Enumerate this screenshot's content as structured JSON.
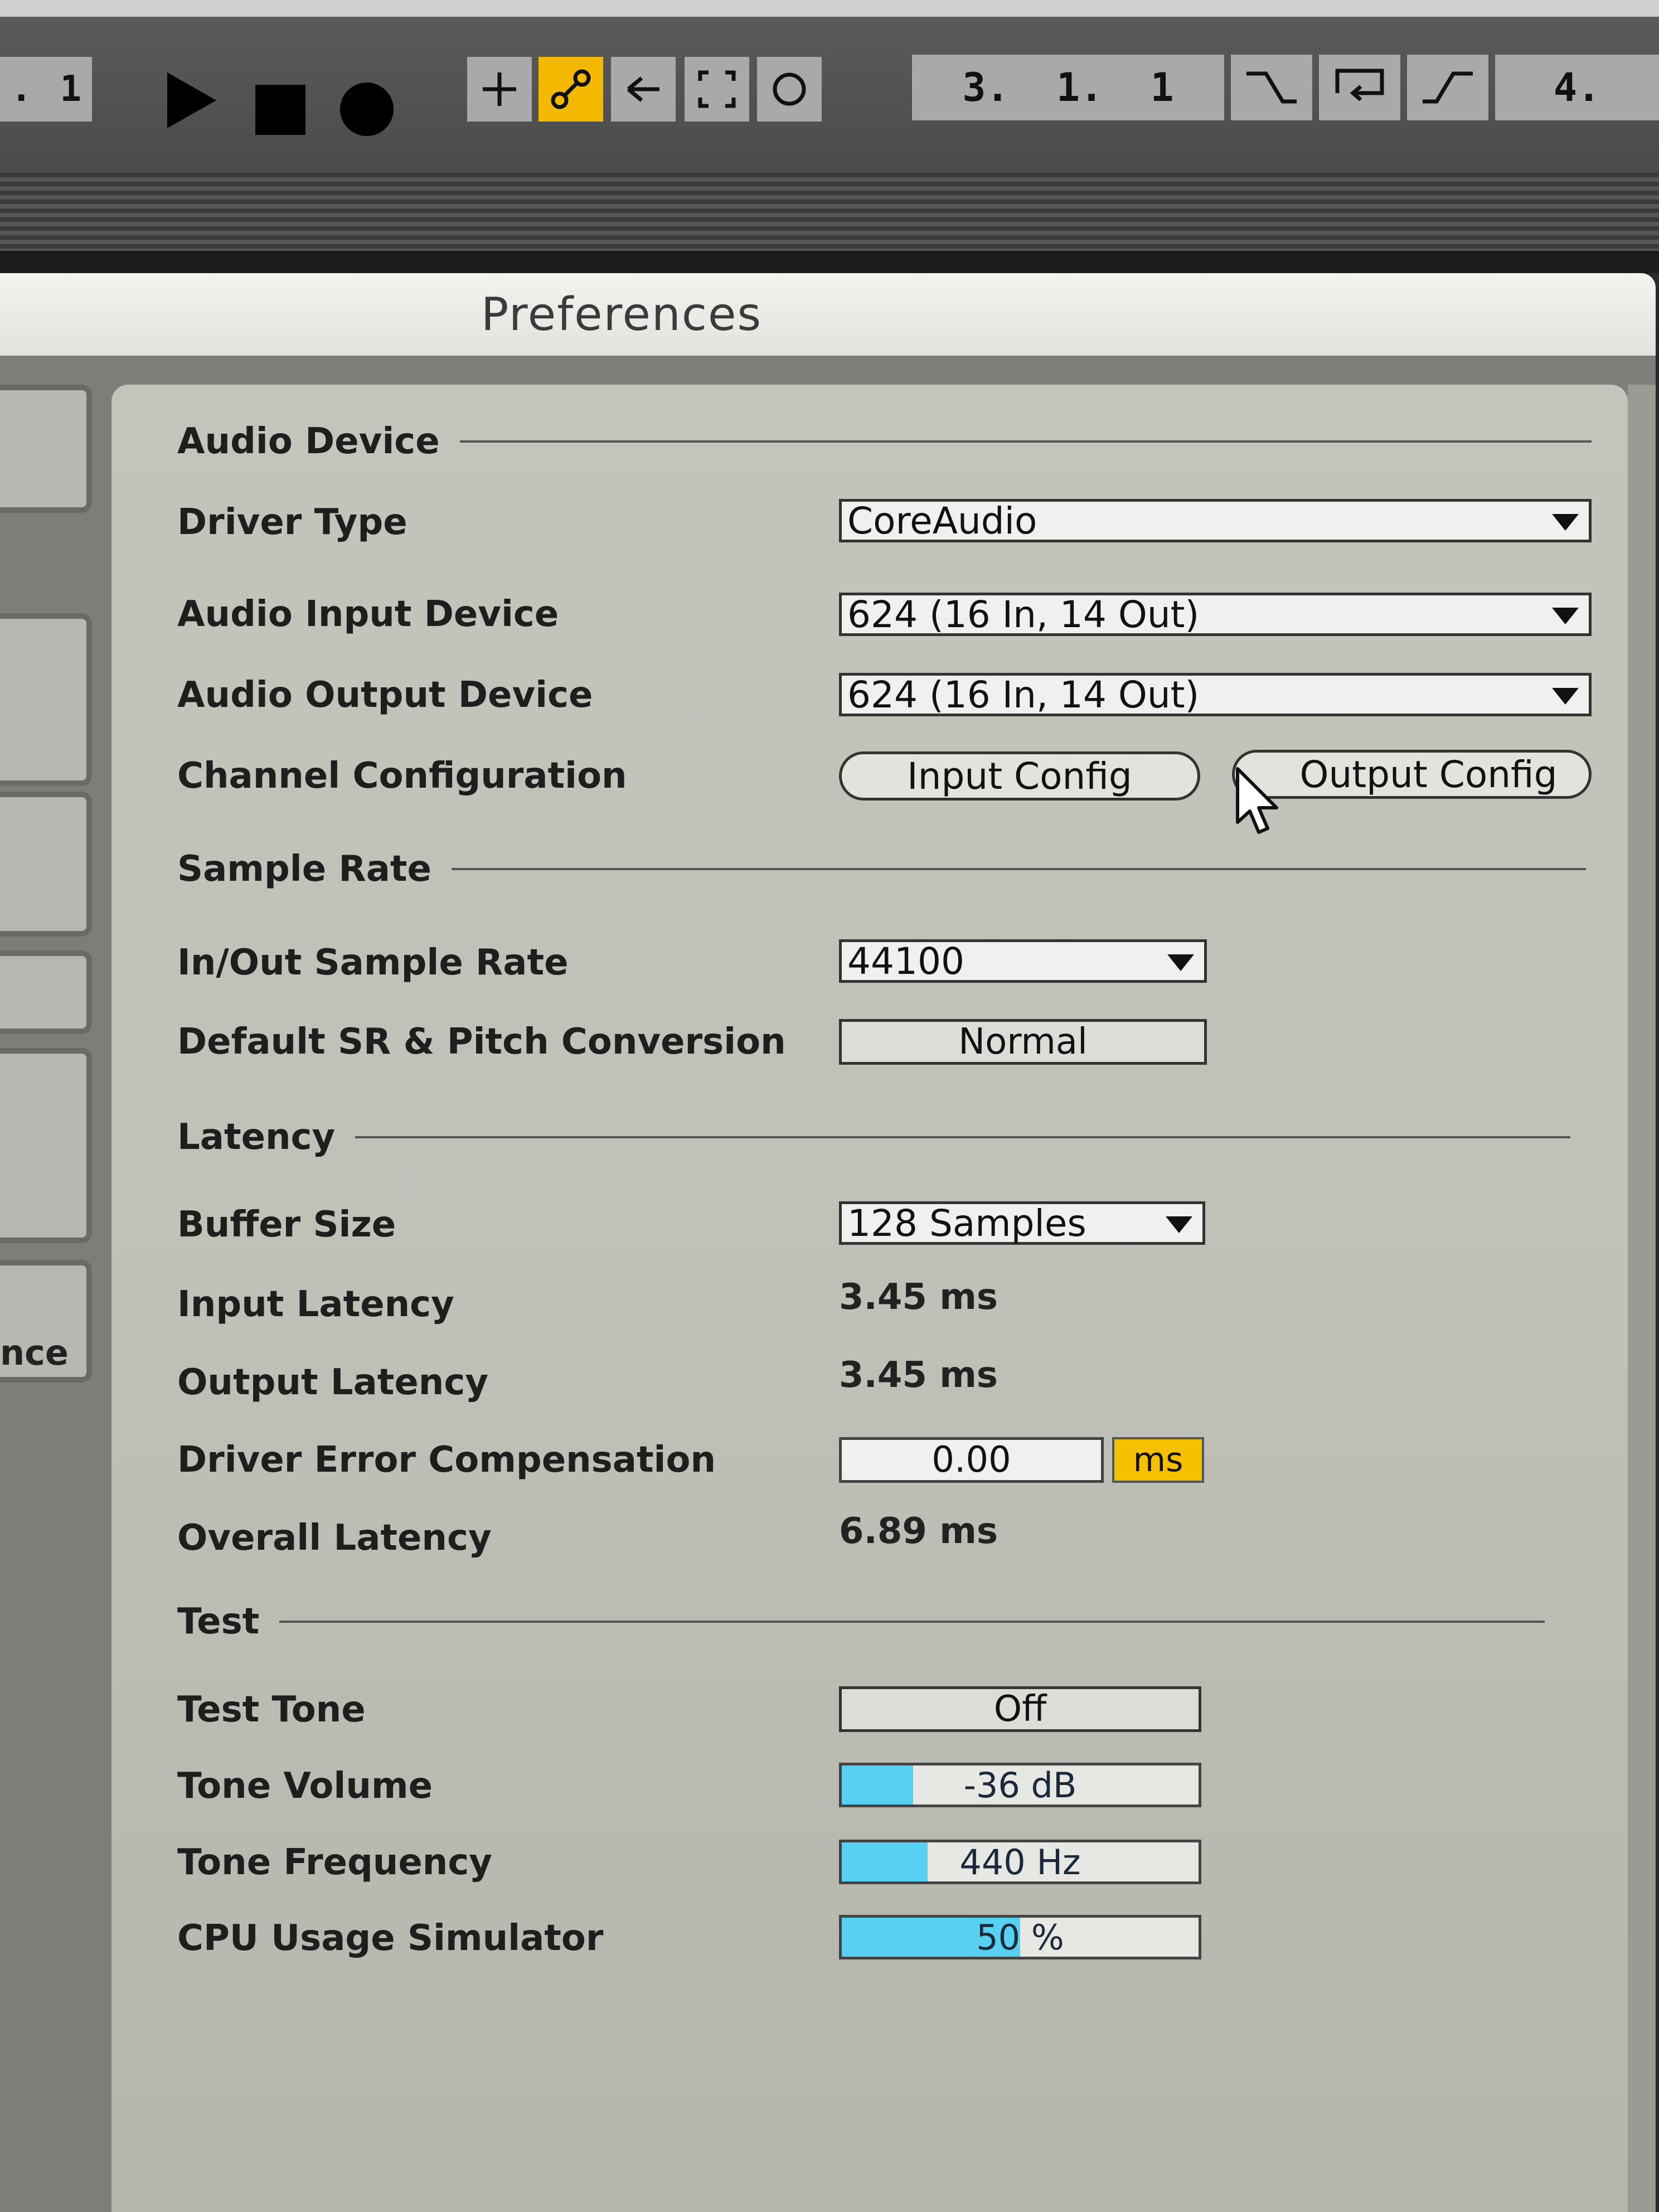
{
  "transport": {
    "left_counter": "1",
    "left_dot": ".",
    "position": "3.  1.  1",
    "right_counter": "4.",
    "icons": [
      "play-icon",
      "stop-icon",
      "record-icon",
      "add-icon",
      "link-icon",
      "back-arrow-icon",
      "loop-bracket-icon",
      "circle-icon",
      "punch-in-icon",
      "loop-icon",
      "punch-out-icon"
    ],
    "accent": "#f4b800"
  },
  "window": {
    "title": "Preferences"
  },
  "sidebar": {
    "partial_label": "nce"
  },
  "audio_device": {
    "heading": "Audio Device",
    "driver_type": {
      "label": "Driver Type",
      "value": "CoreAudio"
    },
    "input_device": {
      "label": "Audio Input Device",
      "value": "624 (16 In, 14 Out)"
    },
    "output_device": {
      "label": "Audio Output Device",
      "value": "624 (16 In, 14 Out)"
    },
    "channel_config": {
      "label": "Channel Configuration",
      "input_button": "Input Config",
      "output_button": "Output Config"
    }
  },
  "sample_rate": {
    "heading": "Sample Rate",
    "in_out": {
      "label": "In/Out Sample Rate",
      "value": "44100"
    },
    "conversion": {
      "label": "Default SR & Pitch Conversion",
      "value": "Normal"
    }
  },
  "latency": {
    "heading": "Latency",
    "buffer_size": {
      "label": "Buffer Size",
      "value": "128 Samples"
    },
    "input_latency": {
      "label": "Input Latency",
      "value": "3.45 ms"
    },
    "output_latency": {
      "label": "Output Latency",
      "value": "3.45 ms"
    },
    "driver_error": {
      "label": "Driver Error Compensation",
      "value": "0.00",
      "unit": "ms"
    },
    "overall": {
      "label": "Overall Latency",
      "value": "6.89 ms"
    }
  },
  "test": {
    "heading": "Test",
    "tone": {
      "label": "Test Tone",
      "value": "Off"
    },
    "volume": {
      "label": "Tone Volume",
      "value": "-36 dB",
      "fill_fraction": 0.2
    },
    "frequency": {
      "label": "Tone Frequency",
      "value": "440 Hz",
      "fill_fraction": 0.24
    },
    "cpu": {
      "label": "CPU Usage Simulator",
      "value": "50 %",
      "fill_fraction": 0.5
    }
  },
  "colors": {
    "slider_fill": "#57d0f2",
    "unit_badge": "#f6c000"
  }
}
